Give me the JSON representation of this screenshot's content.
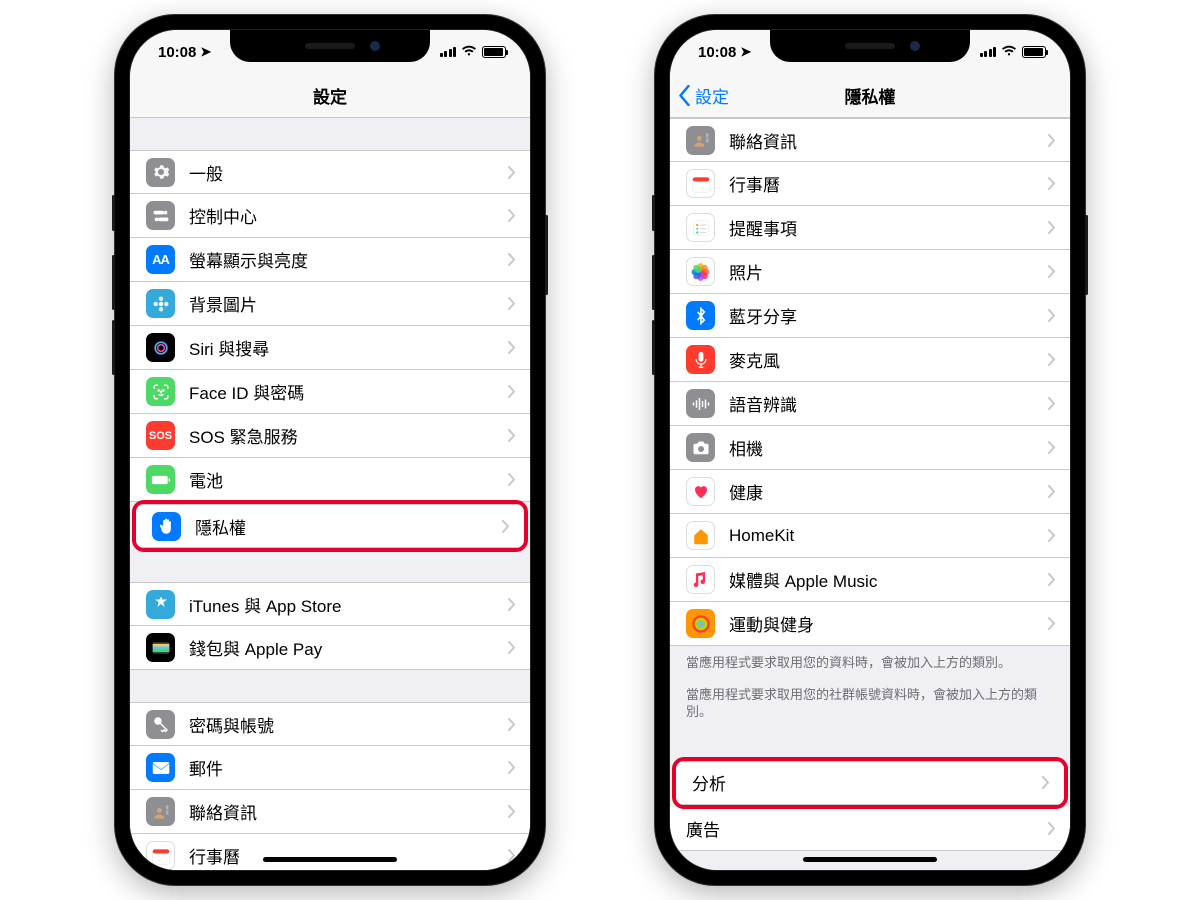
{
  "status": {
    "time": "10:08"
  },
  "left_phone": {
    "nav_title": "設定",
    "groups": [
      {
        "items": [
          {
            "icon": "gear",
            "tint": "gray",
            "label": "一般"
          },
          {
            "icon": "switches",
            "tint": "darkgray",
            "label": "控制中心"
          },
          {
            "icon": "AA",
            "tint": "blue",
            "label": "螢幕顯示與亮度"
          },
          {
            "icon": "flower",
            "tint": "lightblue",
            "label": "背景圖片"
          },
          {
            "icon": "siri",
            "tint": "black",
            "label": "Siri 與搜尋"
          },
          {
            "icon": "faceid",
            "tint": "green",
            "label": "Face ID 與密碼"
          },
          {
            "icon": "SOS",
            "tint": "red",
            "label": "SOS 緊急服務"
          },
          {
            "icon": "battery",
            "tint": "green",
            "label": "電池"
          },
          {
            "icon": "hand",
            "tint": "blue",
            "label": "隱私權",
            "highlight": true
          }
        ]
      },
      {
        "items": [
          {
            "icon": "appstore",
            "tint": "lightblue",
            "label": "iTunes 與 App Store"
          },
          {
            "icon": "wallet",
            "tint": "black",
            "label": "錢包與 Apple Pay"
          }
        ]
      },
      {
        "items": [
          {
            "icon": "key",
            "tint": "gray",
            "label": "密碼與帳號"
          },
          {
            "icon": "mail",
            "tint": "blue",
            "label": "郵件"
          },
          {
            "icon": "contacts",
            "tint": "darkgray",
            "label": "聯絡資訊"
          },
          {
            "icon": "calendar",
            "tint": "white",
            "label": "行事曆"
          }
        ]
      }
    ]
  },
  "right_phone": {
    "nav_title": "隱私權",
    "back_label": "設定",
    "groups": [
      {
        "items": [
          {
            "icon": "contacts",
            "tint": "darkgray",
            "label": "聯絡資訊"
          },
          {
            "icon": "calendar",
            "tint": "white",
            "label": "行事曆"
          },
          {
            "icon": "reminders",
            "tint": "white",
            "label": "提醒事項"
          },
          {
            "icon": "photos",
            "tint": "photos",
            "label": "照片"
          },
          {
            "icon": "bluetooth",
            "tint": "blue",
            "label": "藍牙分享"
          },
          {
            "icon": "mic",
            "tint": "red",
            "label": "麥克風"
          },
          {
            "icon": "waveform",
            "tint": "gray",
            "label": "語音辨識"
          },
          {
            "icon": "camera",
            "tint": "gray",
            "label": "相機"
          },
          {
            "icon": "heart",
            "tint": "white",
            "label": "健康"
          },
          {
            "icon": "home",
            "tint": "white",
            "label": "HomeKit"
          },
          {
            "icon": "music",
            "tint": "white",
            "label": "媒體與 Apple Music"
          },
          {
            "icon": "activity",
            "tint": "orange",
            "label": "運動與健身"
          }
        ],
        "footer1": "當應用程式要求取用您的資料時，會被加入上方的類別。",
        "footer2": "當應用程式要求取用您的社群帳號資料時，會被加入上方的類別。"
      },
      {
        "items": [
          {
            "label": "分析",
            "no_icon": true,
            "highlight": true
          },
          {
            "label": "廣告",
            "no_icon": true
          }
        ]
      }
    ]
  }
}
